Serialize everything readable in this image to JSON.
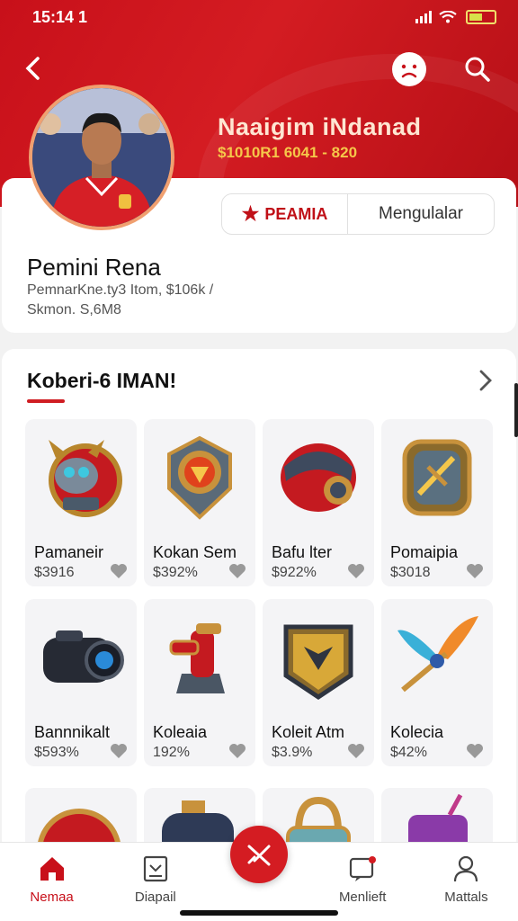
{
  "status_bar": {
    "time": "15:14 1"
  },
  "header": {
    "title": "Naaigim iNdanad",
    "subtitle": "$1010R1 6041 - 820"
  },
  "tags": {
    "premium_label": "PEAMIA",
    "secondary_label": "Mengulalar"
  },
  "profile": {
    "name": "Pemini Rena",
    "meta_line1": "PemnarKne.ty3 Itom, $106k /",
    "meta_line2": "Skmon. S,6M8"
  },
  "collection": {
    "title": "Koberi-6 IMAN!",
    "items": [
      {
        "name": "Pamaneir",
        "price": "$3916",
        "icon": "horned-mask-icon"
      },
      {
        "name": "Kokan Sem",
        "price": "$392%",
        "icon": "crest-shield-icon"
      },
      {
        "name": "Bafu lter",
        "price": "$922%",
        "icon": "armored-helmet-icon"
      },
      {
        "name": "Pomaipia",
        "price": "$3018",
        "icon": "bronze-shield-icon"
      },
      {
        "name": "Bannnikalt",
        "price": "$593%",
        "icon": "camera-device-icon"
      },
      {
        "name": "Koleaia",
        "price": "192%",
        "icon": "red-turret-icon"
      },
      {
        "name": "Koleit Atm",
        "price": "$3.9%",
        "icon": "gold-badge-icon"
      },
      {
        "name": "Kolecia",
        "price": "$42%",
        "icon": "winged-staff-icon"
      }
    ]
  },
  "nav": {
    "items": [
      {
        "label": "Nemaa",
        "icon": "home-icon",
        "active": true
      },
      {
        "label": "Diapail",
        "icon": "document-icon",
        "active": false
      },
      {
        "label": "Menlieft",
        "icon": "notification-icon",
        "active": false
      },
      {
        "label": "Mattals",
        "icon": "user-icon",
        "active": false
      }
    ]
  },
  "colors": {
    "brand_red": "#d41c22",
    "gold": "#f5c74a"
  }
}
